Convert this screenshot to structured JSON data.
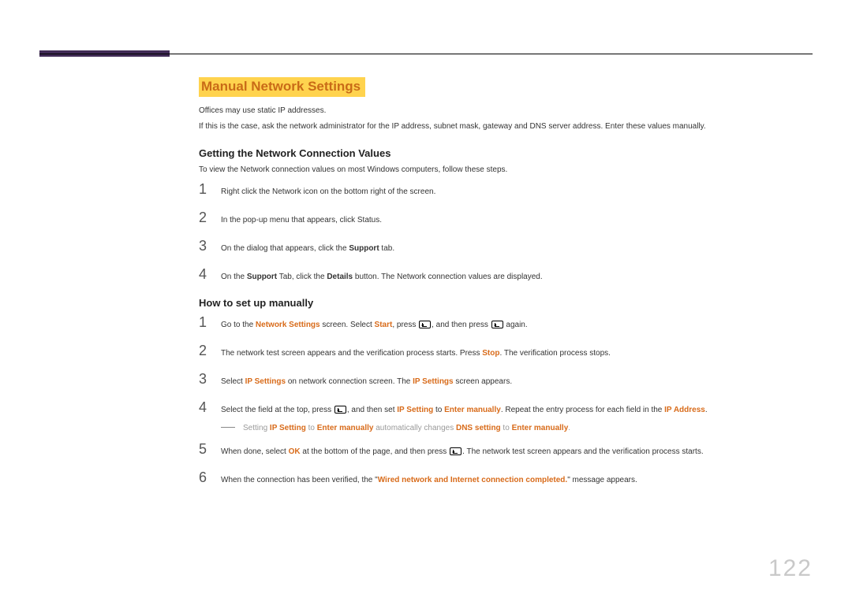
{
  "page_number": "122",
  "title": "Manual Network Settings",
  "intro1": "Offices may use static IP addresses.",
  "intro2": "If this is the case, ask the network administrator for the IP address, subnet mask, gateway and DNS server address. Enter these values manually.",
  "section1": {
    "heading": "Getting the Network Connection Values",
    "intro": "To view the Network connection values on most Windows computers, follow these steps.",
    "steps": {
      "s1": "Right click the Network icon on the bottom right of the screen.",
      "s2": "In the pop-up menu that appears, click Status.",
      "s3_pre": "On the dialog that appears, click the ",
      "s3_b": "Support",
      "s3_post": " tab.",
      "s4_pre": "On the ",
      "s4_b1": "Support",
      "s4_mid": " Tab, click the ",
      "s4_b2": "Details",
      "s4_post": " button. The Network connection values are displayed."
    }
  },
  "section2": {
    "heading": "How to set up manually",
    "steps": {
      "s1_pre": "Go to the ",
      "s1_hl1": "Network Settings",
      "s1_mid1": " screen. Select ",
      "s1_hl2": "Start",
      "s1_mid2": ", press ",
      "s1_mid3": ", and then press ",
      "s1_post": " again.",
      "s2_pre": "The network test screen appears and the verification process starts. Press ",
      "s2_hl": "Stop",
      "s2_post": ". The verification process stops.",
      "s3_pre": "Select ",
      "s3_hl1": "IP Settings",
      "s3_mid": " on network connection screen. The ",
      "s3_hl2": "IP Settings",
      "s3_post": " screen appears.",
      "s4_pre": "Select the field at the top, press ",
      "s4_mid1": ", and then set ",
      "s4_hl1": "IP Setting",
      "s4_mid2": " to ",
      "s4_hl2": "Enter manually",
      "s4_mid3": ". Repeat the entry process for each field in the ",
      "s4_hl3": "IP Address",
      "s4_post": ".",
      "note_pre": "Setting ",
      "note_hl1": "IP Setting",
      "note_mid1": " to ",
      "note_hl2": "Enter manually",
      "note_mid2": " automatically changes ",
      "note_hl3": "DNS setting",
      "note_mid3": " to ",
      "note_hl4": "Enter manually",
      "note_post": ".",
      "s5_pre": "When done, select ",
      "s5_hl": "OK",
      "s5_mid": " at the bottom of the page, and then press ",
      "s5_post": ". The network test screen appears and the verification process starts.",
      "s6_pre": "When the connection has been verified, the \"",
      "s6_hl": "Wired network and Internet connection completed.",
      "s6_post": "\" message appears."
    }
  }
}
